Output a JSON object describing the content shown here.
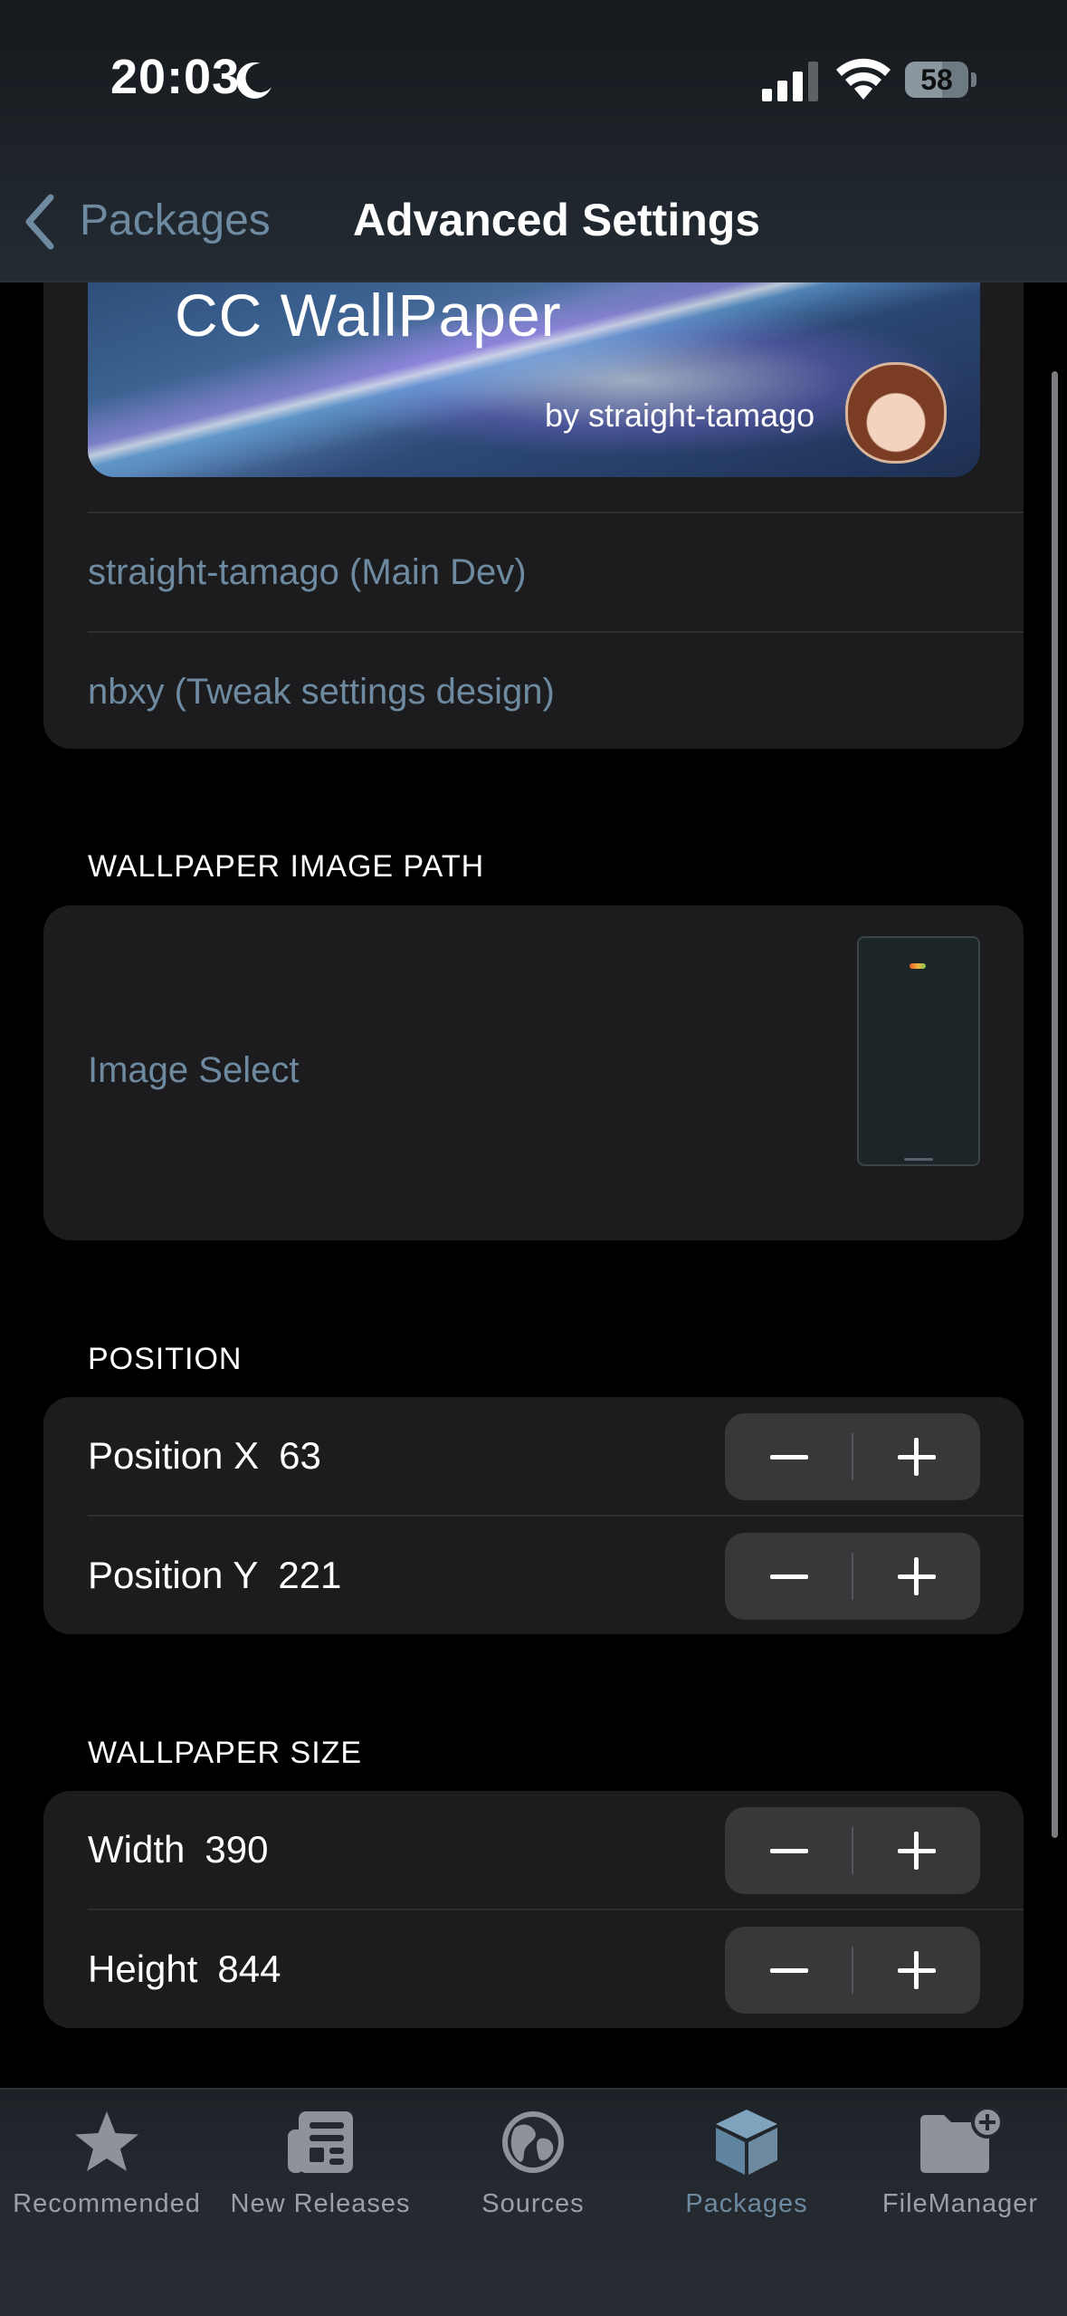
{
  "status_bar": {
    "time": "20:03",
    "battery": "58"
  },
  "nav": {
    "back_label": "Packages",
    "title": "Advanced Settings"
  },
  "banner": {
    "title": "CC WallPaper",
    "author": "by straight-tamago"
  },
  "credits": [
    {
      "label": "straight-tamago (Main Dev)"
    },
    {
      "label": "nbxy (Tweak settings design)"
    }
  ],
  "wallpaper_image_path": {
    "header": "WALLPAPER IMAGE PATH",
    "label": "Image Select"
  },
  "position": {
    "header": "POSITION",
    "x": {
      "label": "Position X",
      "value": "63"
    },
    "y": {
      "label": "Position Y",
      "value": "221"
    }
  },
  "wallpaper_size": {
    "header": "WALLPAPER SIZE",
    "width": {
      "label": "Width",
      "value": "390"
    },
    "height": {
      "label": "Height",
      "value": "844"
    }
  },
  "tabs": [
    {
      "label": "Recommended",
      "icon": "star-icon"
    },
    {
      "label": "New Releases",
      "icon": "newspaper-icon"
    },
    {
      "label": "Sources",
      "icon": "globe-icon"
    },
    {
      "label": "Packages",
      "icon": "package-icon",
      "active": true
    },
    {
      "label": "FileManager",
      "icon": "folder-add-icon"
    }
  ],
  "colors": {
    "accent": "#6d8aa0",
    "background": "#000000",
    "group": "#1c1c1e",
    "stepper": "#38383b"
  }
}
